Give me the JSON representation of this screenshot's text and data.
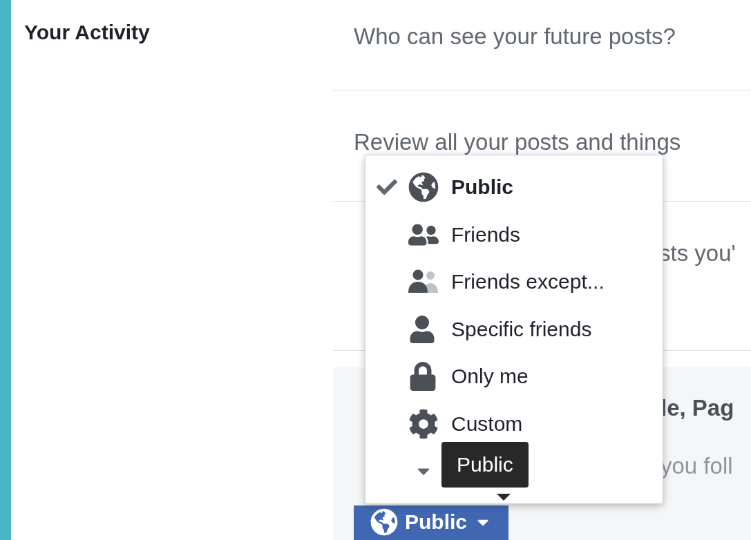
{
  "sidebar": {
    "title": "Your Activity"
  },
  "rows": [
    {
      "kind": "full",
      "text": "Who can see your future posts?"
    },
    {
      "kind": "full",
      "text": "Review all your posts and things"
    },
    {
      "kind": "covered",
      "text": "sts you'"
    }
  ],
  "section": {
    "title": "le, Pag",
    "subtitle": "you foll",
    "button": {
      "label": "Public"
    }
  },
  "menu": {
    "items": [
      {
        "kind": "globe",
        "label": "Public",
        "selected": true
      },
      {
        "kind": "friends",
        "label": "Friends",
        "selected": false
      },
      {
        "kind": "friends-except",
        "label": "Friends except...",
        "selected": false
      },
      {
        "kind": "person",
        "label": "Specific friends",
        "selected": false
      },
      {
        "kind": "lock",
        "label": "Only me",
        "selected": false
      },
      {
        "kind": "gear",
        "label": "Custom",
        "selected": false
      }
    ],
    "tooltip": "Public"
  }
}
